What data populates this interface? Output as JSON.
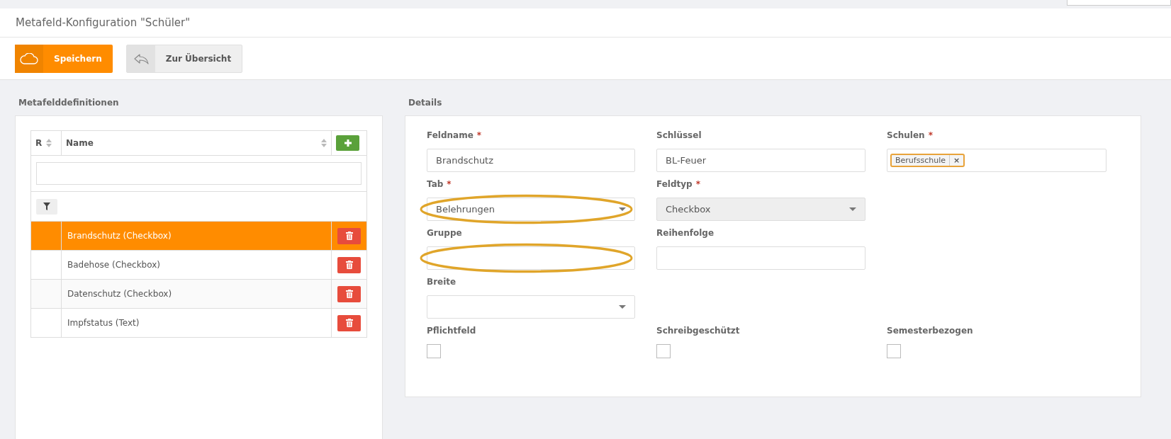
{
  "page_title": "Metafeld-Konfiguration \"Schüler\"",
  "toolbar": [
    {
      "kind": "primary",
      "label": "Speichern"
    },
    {
      "kind": "secondary",
      "label": "Zur Übersicht"
    }
  ],
  "list_panel": {
    "title": "Metafelddefinitionen",
    "columns": [
      "R",
      "Name"
    ],
    "rows": [
      {
        "name": "Brandschutz (Checkbox)",
        "selected": true
      },
      {
        "name": "Badehose (Checkbox)",
        "selected": false
      },
      {
        "name": "Datenschutz (Checkbox)",
        "selected": false
      },
      {
        "name": "Impfstatus (Text)",
        "selected": false
      }
    ]
  },
  "details": {
    "title": "Details",
    "fields": [
      {
        "kind": "text",
        "label": "Feldname",
        "required_mark": "*",
        "value": "Brandschutz",
        "highlighted": false
      },
      {
        "kind": "text",
        "label": "Schlüssel",
        "value": "BL-Feuer",
        "highlighted": false
      },
      {
        "kind": "tags",
        "label": "Schulen",
        "required_mark": "*",
        "tags": [
          {
            "label": "Berufsschule",
            "remove": "×"
          }
        ],
        "highlighted": false
      },
      {
        "kind": "select",
        "label": "Tab",
        "required_mark": "*",
        "value": "Belehrungen",
        "disabled": false,
        "highlighted": true
      },
      {
        "kind": "select",
        "label": "Feldtyp",
        "required_mark": "*",
        "value": "Checkbox",
        "disabled": true,
        "highlighted": false
      },
      {
        "kind": "empty"
      },
      {
        "kind": "text",
        "label": "Gruppe",
        "highlighted": true
      },
      {
        "kind": "text",
        "label": "Reihenfolge",
        "highlighted": false
      },
      {
        "kind": "empty"
      },
      {
        "kind": "select",
        "label": "Breite",
        "disabled": false,
        "highlighted": false
      },
      {
        "kind": "empty"
      },
      {
        "kind": "empty"
      },
      {
        "kind": "checkbox",
        "label": "Pflichtfeld",
        "checked": false
      },
      {
        "kind": "checkbox",
        "label": "Schreibgeschützt",
        "checked": false
      },
      {
        "kind": "checkbox",
        "label": "Semesterbezogen",
        "checked": false
      }
    ]
  }
}
